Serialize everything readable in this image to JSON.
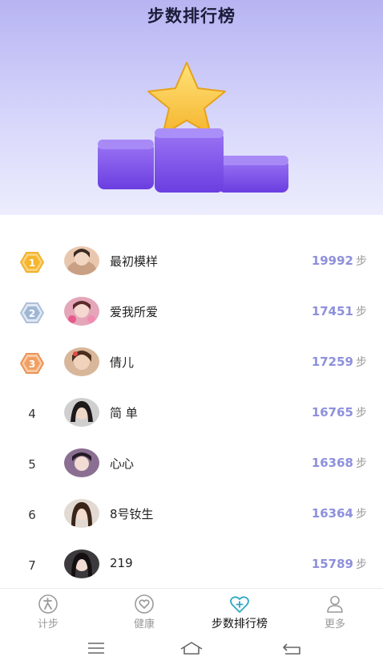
{
  "header": {
    "title": "步数排行榜"
  },
  "leaderboard": {
    "step_unit": "步",
    "rows": [
      {
        "rank": "1",
        "name": "最初模样",
        "steps": "19992"
      },
      {
        "rank": "2",
        "name": "爱我所爱",
        "steps": "17451"
      },
      {
        "rank": "3",
        "name": "倩儿",
        "steps": "17259"
      },
      {
        "rank": "4",
        "name": "简 单",
        "steps": "16765"
      },
      {
        "rank": "5",
        "name": "心心",
        "steps": "16368"
      },
      {
        "rank": "6",
        "name": "8号钕生",
        "steps": "16364"
      },
      {
        "rank": "7",
        "name": "219",
        "steps": "15789"
      }
    ]
  },
  "tabbar": {
    "tabs": [
      {
        "label": "计步",
        "icon": "walking-icon",
        "active": false
      },
      {
        "label": "健康",
        "icon": "heart-icon",
        "active": false
      },
      {
        "label": "步数排行榜",
        "icon": "heart-plus-icon",
        "active": true
      },
      {
        "label": "更多",
        "icon": "user-icon",
        "active": false
      }
    ]
  },
  "colors": {
    "accent": "#8e90dc",
    "gold": "#f5b52e",
    "silver": "#9fb6d4",
    "bronze": "#f0a062",
    "podium": "#7b50e8",
    "active_tab": "#2fa8c6"
  }
}
